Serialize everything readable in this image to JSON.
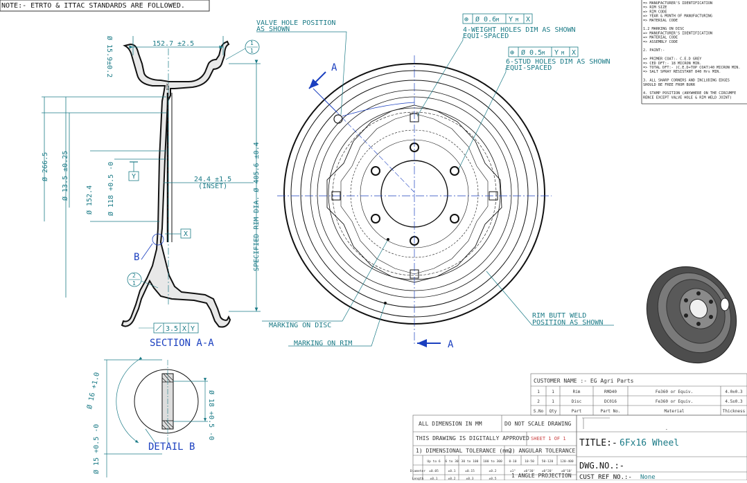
{
  "note": "NOTE:- ETRTO & ITTAC STANDARDS ARE FOLLOWED.",
  "section": {
    "label": "SECTION A-A",
    "dims": {
      "flange_dia": "Ø 15.9±0.2",
      "width": "152.7 ±2.5",
      "d266": "Ø 266.5",
      "d13": "Ø 13.5 ±0.25",
      "d152": "Ø 152.4",
      "d118": "Ø 118 +0.5 -0",
      "inset": "24.4 ±1.5",
      "inset_sub": "(INSET)",
      "rim_dia": "SPECIFIED RIM DIA. Ø 405.6 ±0.4",
      "runout": "3.5",
      "datum_x": "X",
      "datum_y": "Y",
      "b": "B",
      "balloon1_top": "1",
      "balloon1_bot": "1",
      "balloon2_top": "2",
      "balloon2_bot": "1"
    }
  },
  "front": {
    "valve_hole": [
      "VALVE HOLE POSITION",
      "AS SHOWN"
    ],
    "weight_holes_fcf": [
      "⊕",
      "Ø 0.6",
      "M",
      "Y",
      "M",
      "X"
    ],
    "weight_holes": [
      "4-WEIGHT HOLES DIM AS SHOWN",
      "EQUI-SPACED"
    ],
    "stud_holes_fcf": [
      "⊕",
      "Ø 0.5",
      "M",
      "Y",
      "M",
      "X"
    ],
    "stud_holes": [
      "6-STUD HOLES DIM AS SHOWN",
      "EQUI-SPACED"
    ],
    "section_a": "A",
    "marking_disc": "MARKING ON DISC",
    "marking_rim": "MARKING ON RIM",
    "rim_butt": [
      "RIM BUTT WELD",
      "POSITION AS SHOWN"
    ]
  },
  "detail": {
    "label": "DETAIL B",
    "d18": "Ø 18 +0.5 -0",
    "d16": "Ø 16 +1.0",
    "d15": "Ø 15 +0.5 -0"
  },
  "notes": [
    "=> MANUFACTURER'S IDENTIFICATION",
    "=> RIM SIZE",
    "=> RIM CODE",
    "=> YEAR & MONTH OF MANUFACTURING",
    "=> MATERIAL CODE",
    "",
    "1.2 MARKING ON DISC",
    "=> MANUFACTURER'S IDENTIFICATION",
    "=> MATERIAL CODE",
    "=> ASSEMBLY CODE",
    "",
    "2.  PAINT:-",
    "",
    "=> PRIMER COAT:- C.E.D GREY",
    "=> CED DFT:- 18 MICRON MIN.",
    "=> TOTAL DFT:- (C.E.D+TOP COAT)40 MICRON MIN.",
    "=> SALT SPRAY RESISTANT 840 Hrs MIN.",
    "",
    "3.  ALL SHARP CORNERS AND INCLUDING EDGES",
    "    SHOULD BE FREE FROM BURR",
    "",
    "4.  STAMP POSITION (ANYWHERE ON THE CIRCUMFE",
    "    RENCE EXCEPT VALVE HOLE & RIM WELD JOINT)"
  ],
  "title_block": {
    "customer": "CUSTOMER NAME :- EG Agri Parts",
    "bom_rows": [
      [
        "1",
        "1",
        "Rim",
        "RMD40",
        "Fe360 or Equiv.",
        "4.0±0.3"
      ],
      [
        "2",
        "1",
        "Disc",
        "DC016",
        "Fe360 or Equiv.",
        "4.5±0.3"
      ]
    ],
    "bom_header": [
      "S.No",
      "Qty",
      "Part",
      "Part No.",
      "Material",
      "Thickness"
    ],
    "all_dim": "ALL DIMENSION IN MM",
    "do_not_scale": "DO NOT SCALE DRAWING",
    "digital": "THIS DRAWING IS DIGITALLY APPROVED",
    "sheet": "SHEET 1 OF 1",
    "dim_tol": "1) DIMENSIONAL TOLERANCE (mm)",
    "ang_tol": "2) ANGULAR TOLERANCE",
    "tol_header": [
      "",
      "Up to 6",
      "6 to 30",
      "30 to 100",
      "100 to 300",
      "0-10",
      "10-50",
      "50-120",
      "120-400"
    ],
    "tol_diameter": [
      "Diameter",
      "±0.05",
      "±0.1",
      "±0.15",
      "±0.2",
      "±1°",
      "±0°30'",
      "±0°20'",
      "±0°10'"
    ],
    "tol_length": [
      "Length",
      "±0.1",
      "±0.2",
      "±0.3",
      "±0.5"
    ],
    "projection": "1 ANGLE PROJECTION",
    "title_prefix": "TITLE:-",
    "title": "6Fx16 Wheel",
    "dwg_no": "DWG.NO.:-",
    "cust_ref_prefix": "CUST REF NO.:-",
    "cust_ref": "None",
    "dash": "-"
  }
}
